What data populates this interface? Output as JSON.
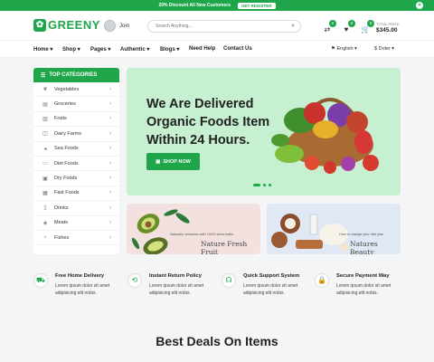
{
  "topbar": {
    "text": "20% Discount All New Customers",
    "button": "GET REGISTER"
  },
  "header": {
    "logo": "GREENY",
    "join": "Join",
    "search_placeholder": "Search Anything...",
    "compare_count": "0",
    "wishlist_count": "0",
    "cart_count": "0",
    "total_label": "TOTAL PRICE",
    "total_value": "$345.00"
  },
  "nav": {
    "items": [
      "Home ▾",
      "Shop ▾",
      "Pages ▾",
      "Authentic ▾",
      "Blogs ▾",
      "Need Help",
      "Contact Us"
    ],
    "language": "English ▾",
    "currency": "Doler ▾"
  },
  "sidebar": {
    "title": "TOP CATEGORIES",
    "categories": [
      "Vegetables",
      "Groceries",
      "Fruits",
      "Dairy Farms",
      "Sea Foods",
      "Diet Foods",
      "Dry Foods",
      "Fast Foods",
      "Drinks",
      "Meats",
      "Fishes"
    ]
  },
  "hero": {
    "headline": "We Are Delivered Organic Foods Item Within 24 Hours.",
    "button": "SHOP NOW"
  },
  "banners": [
    {
      "small": "Naturally verisalize with 100% shea butter",
      "big": "Nature Fresh Fruit"
    },
    {
      "small": "How to change your diet plan",
      "big": "Natures Beauty"
    }
  ],
  "features": [
    {
      "title": "Free Home Delivery",
      "desc": "Lorem ipsum dolor sit amet adipisicing elit nobis."
    },
    {
      "title": "Instant Return Policy",
      "desc": "Lorem ipsum dolor sit amet adipisicing elit nobis."
    },
    {
      "title": "Quick Support System",
      "desc": "Lorem ipsum dolor sit amet adipisicing elit nobis."
    },
    {
      "title": "Secure Payment Way",
      "desc": "Lorem ipsum dolor sit amet adipisicing elit nobis."
    }
  ],
  "section_title": "Best Deals On Items",
  "colors": {
    "primary": "#1fa64a",
    "hero_bg": "#c6f0cf",
    "banner1_bg": "#f3e1df",
    "banner2_bg": "#dfe8f4"
  }
}
